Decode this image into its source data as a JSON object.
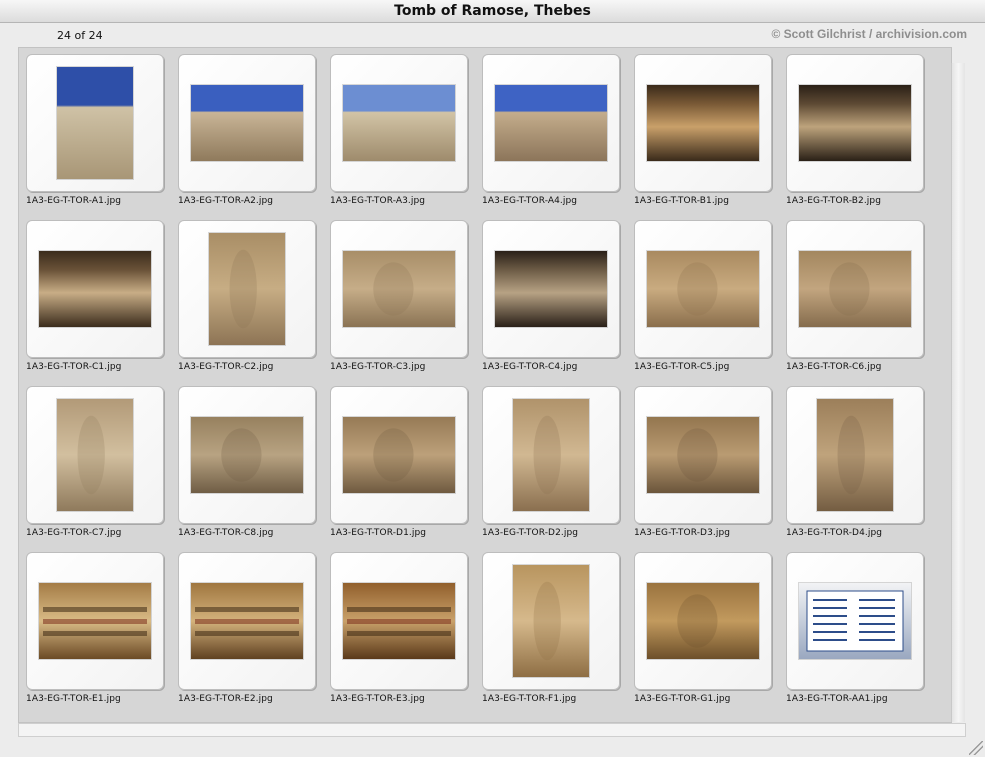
{
  "window": {
    "title": "Tomb of Ramose, Thebes"
  },
  "infobar": {
    "count": "24 of 24",
    "copyright": "© Scott Gilchrist / archivision.com"
  },
  "thumbnails": [
    {
      "filename": "1A3-EG-T-TOR-A1.jpg",
      "orientation": "portrait",
      "colors": [
        "#2e4fa8",
        "#cfc2a6",
        "#a89676"
      ],
      "subject": "sky"
    },
    {
      "filename": "1A3-EG-T-TOR-A2.jpg",
      "orientation": "landscape",
      "colors": [
        "#3a5fbf",
        "#c9b597",
        "#8f7a5c"
      ],
      "subject": "sky"
    },
    {
      "filename": "1A3-EG-T-TOR-A3.jpg",
      "orientation": "landscape",
      "colors": [
        "#6c8ed2",
        "#d2c4a6",
        "#9e8b6c"
      ],
      "subject": "sky"
    },
    {
      "filename": "1A3-EG-T-TOR-A4.jpg",
      "orientation": "landscape",
      "colors": [
        "#3e63c4",
        "#c4ad8c",
        "#8c755a"
      ],
      "subject": "sky"
    },
    {
      "filename": "1A3-EG-T-TOR-B1.jpg",
      "orientation": "landscape",
      "colors": [
        "#3a2a1a",
        "#c9a06a",
        "#7a5a36"
      ],
      "subject": "interior"
    },
    {
      "filename": "1A3-EG-T-TOR-B2.jpg",
      "orientation": "landscape",
      "colors": [
        "#2a2016",
        "#bda37c",
        "#5e4a34"
      ],
      "subject": "interior"
    },
    {
      "filename": "1A3-EG-T-TOR-C1.jpg",
      "orientation": "landscape",
      "colors": [
        "#3b2c1c",
        "#c8ad86",
        "#6a5238"
      ],
      "subject": "interior"
    },
    {
      "filename": "1A3-EG-T-TOR-C2.jpg",
      "orientation": "portrait",
      "colors": [
        "#c7ad84",
        "#a98e66",
        "#8d7455"
      ],
      "subject": "relief"
    },
    {
      "filename": "1A3-EG-T-TOR-C3.jpg",
      "orientation": "landscape",
      "colors": [
        "#c6ad88",
        "#a88e68",
        "#8a7354"
      ],
      "subject": "relief"
    },
    {
      "filename": "1A3-EG-T-TOR-C4.jpg",
      "orientation": "landscape",
      "colors": [
        "#2a2018",
        "#b7a284",
        "#6d5c46"
      ],
      "subject": "interior"
    },
    {
      "filename": "1A3-EG-T-TOR-C5.jpg",
      "orientation": "landscape",
      "colors": [
        "#c9ab80",
        "#a98a60",
        "#8a6e4c"
      ],
      "subject": "relief"
    },
    {
      "filename": "1A3-EG-T-TOR-C6.jpg",
      "orientation": "landscape",
      "colors": [
        "#c2a57f",
        "#a3875f",
        "#856c4d"
      ],
      "subject": "relief"
    },
    {
      "filename": "1A3-EG-T-TOR-C7.jpg",
      "orientation": "portrait",
      "colors": [
        "#d2bf9f",
        "#b29a78",
        "#8f7a5c"
      ],
      "subject": "relief"
    },
    {
      "filename": "1A3-EG-T-TOR-C8.jpg",
      "orientation": "landscape",
      "colors": [
        "#b8a382",
        "#97815f",
        "#6f5d45"
      ],
      "subject": "relief"
    },
    {
      "filename": "1A3-EG-T-TOR-D1.jpg",
      "orientation": "landscape",
      "colors": [
        "#bca07a",
        "#967a56",
        "#6f5a40"
      ],
      "subject": "relief"
    },
    {
      "filename": "1A3-EG-T-TOR-D2.jpg",
      "orientation": "portrait",
      "colors": [
        "#d1b892",
        "#b0936b",
        "#8a6f4f"
      ],
      "subject": "relief"
    },
    {
      "filename": "1A3-EG-T-TOR-D3.jpg",
      "orientation": "landscape",
      "colors": [
        "#b99b72",
        "#93764f",
        "#6b553b"
      ],
      "subject": "relief"
    },
    {
      "filename": "1A3-EG-T-TOR-D4.jpg",
      "orientation": "portrait",
      "colors": [
        "#bfa37c",
        "#9c7f5a",
        "#745d42"
      ],
      "subject": "relief"
    },
    {
      "filename": "1A3-EG-T-TOR-E1.jpg",
      "orientation": "landscape",
      "colors": [
        "#d9bb86",
        "#a47c46",
        "#6b4a25"
      ],
      "subject": "painted"
    },
    {
      "filename": "1A3-EG-T-TOR-E2.jpg",
      "orientation": "landscape",
      "colors": [
        "#d4b27c",
        "#9f763f",
        "#5f4121"
      ],
      "subject": "painted"
    },
    {
      "filename": "1A3-EG-T-TOR-E3.jpg",
      "orientation": "landscape",
      "colors": [
        "#c9a16a",
        "#915f2c",
        "#5a391a"
      ],
      "subject": "painted"
    },
    {
      "filename": "1A3-EG-T-TOR-F1.jpg",
      "orientation": "portrait",
      "colors": [
        "#d6b98c",
        "#b8955f",
        "#8e6e44"
      ],
      "subject": "relief"
    },
    {
      "filename": "1A3-EG-T-TOR-G1.jpg",
      "orientation": "landscape",
      "colors": [
        "#c29a5e",
        "#9a733f",
        "#6d4f2a"
      ],
      "subject": "relief"
    },
    {
      "filename": "1A3-EG-T-TOR-AA1.jpg",
      "orientation": "landscape",
      "colors": [
        "#f2f3f5",
        "#2d4d8a",
        "#9aa8c0"
      ],
      "subject": "sign"
    }
  ]
}
